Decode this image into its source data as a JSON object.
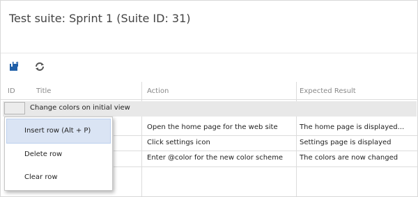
{
  "page": {
    "title": "Test suite: Sprint 1 (Suite ID: 31)"
  },
  "toolbar": {
    "save_icon": "save-icon",
    "refresh_icon": "refresh-icon"
  },
  "grid": {
    "columns": [
      "ID",
      "Title",
      "Action",
      "Expected Result"
    ],
    "selected_row_title": "Change colors on initial view",
    "steps": [
      {
        "action": "Open the home page for the web site",
        "expected": "The home page is displayed..."
      },
      {
        "action": "Click settings icon",
        "expected": "Settings page is displayed"
      },
      {
        "action": "Enter @color for the new color scheme",
        "expected": "The colors are now changed"
      }
    ]
  },
  "context_menu": {
    "items": [
      "Insert row (Alt + P)",
      "Delete row",
      "Clear row"
    ]
  },
  "colors": {
    "accent": "#1f5fa8",
    "selection": "#e8e8e8",
    "menu_hover": "#dae4f4"
  }
}
